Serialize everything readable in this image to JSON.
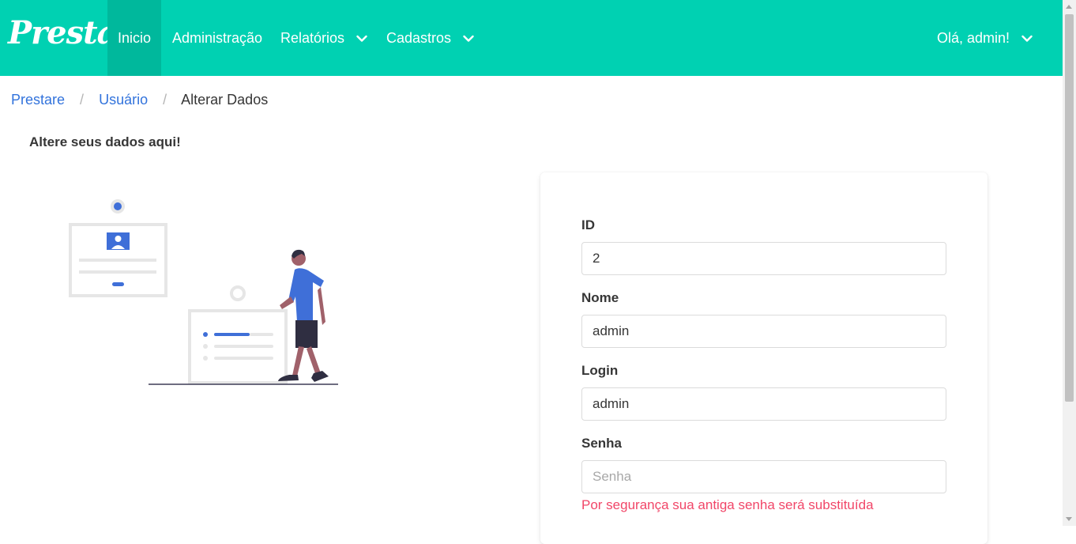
{
  "navbar": {
    "brand": "Prestare",
    "items": [
      {
        "label": "Inicio",
        "active": true
      },
      {
        "label": "Administração"
      },
      {
        "label": "Relatórios",
        "icon": "chevron-down-icon"
      },
      {
        "label": "Cadastros",
        "icon": "chevron-down-icon"
      }
    ],
    "user": {
      "label": "Olá, admin!",
      "icon": "chevron-down-icon"
    },
    "bg_color": "#00d1b2",
    "active_color": "#00b89c"
  },
  "breadcrumb": [
    "Prestare",
    "Usuário",
    "Alterar Dados"
  ],
  "page": {
    "subtitle": "Altere seus dados aqui!"
  },
  "form": {
    "id": {
      "label": "ID",
      "value": "2"
    },
    "nome": {
      "label": "Nome",
      "value": "admin"
    },
    "login": {
      "label": "Login",
      "value": "admin"
    },
    "senha": {
      "label": "Senha",
      "value": "",
      "placeholder": "Senha",
      "help": "Por segurança sua antiga senha será substituída"
    }
  },
  "colors": {
    "link": "#3273dc",
    "danger": "#f14668",
    "illustration_accent": "#3f6fd8"
  }
}
